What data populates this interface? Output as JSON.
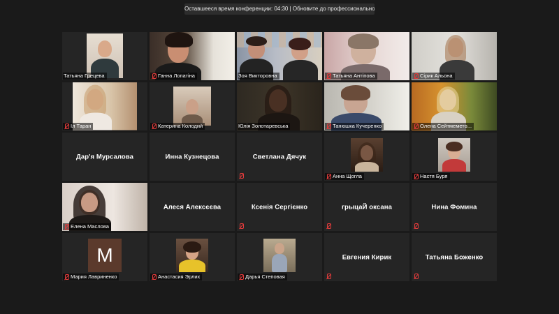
{
  "banner": {
    "text": "Оставшееся время конференции: 04:30 | Обновите до профессиональной версии"
  },
  "tiles": [
    {
      "name": "Татьяна Грецева"
    },
    {
      "name": "Ганна Лопатіна"
    },
    {
      "name": "Зоя Викторовна"
    },
    {
      "name": "Татьяна Антіпова"
    },
    {
      "name": "Сірик Альона"
    },
    {
      "name": "Іл Таран"
    },
    {
      "name": "Катерина Колодий"
    },
    {
      "name": "Юлія Золотаревська"
    },
    {
      "name": "Танюшка Кучеренко"
    },
    {
      "name": "Олена Сейтмемето..."
    },
    {
      "name": "Дар'я Мурсалова"
    },
    {
      "name": "Инна Кузнецова"
    },
    {
      "name": "Светлана Дячук"
    },
    {
      "name": "Анна Щогла"
    },
    {
      "name": "Настя Буря"
    },
    {
      "name": "Елена Маслова"
    },
    {
      "name": "Алеся Алексєєва"
    },
    {
      "name": "Ксенія Сергієнко"
    },
    {
      "name": "грыцаЙ оксана"
    },
    {
      "name": "Нина Фомина"
    },
    {
      "name": "Мария Лавриненко",
      "avatar_letter": "M"
    },
    {
      "name": "Анастасия Эрлих"
    },
    {
      "name": "Дарья Степовая"
    },
    {
      "name": "Евгения Кирик"
    },
    {
      "name": "Татьяна Боженко"
    }
  ],
  "colors": {
    "background": "#1a1a1a",
    "tile": "#252525",
    "active_speaker": "#f2e44e",
    "muted_mic": "#e23b3b",
    "avatar_m": "#5b3a2c"
  },
  "icons": {
    "muted": "mic-muted-icon"
  }
}
